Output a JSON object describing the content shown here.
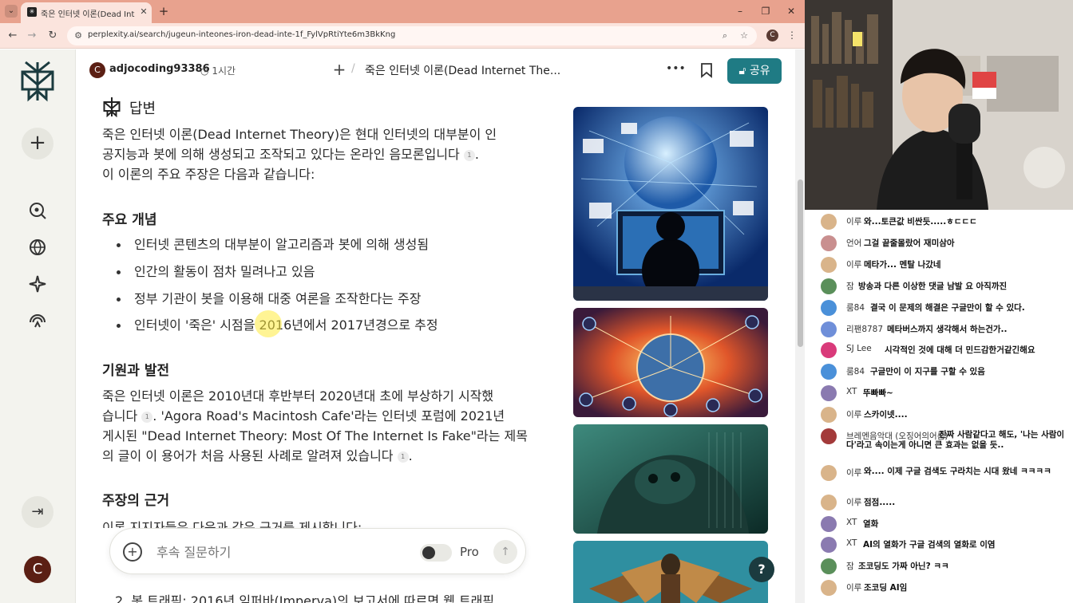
{
  "browser": {
    "tab_title": "죽은 인터넷 이론(Dead Internet",
    "url": "perplexity.ai/search/jugeun-inteones-iron-dead-inte-1f_FylVpRtiYte6m3BkKng",
    "profile_initial": "C"
  },
  "header": {
    "avatar_initial": "C",
    "username": "adjocoding93386",
    "time": "1시간",
    "thread_title": "죽은 인터넷 이론(Dead Internet The...",
    "share_label": "공유"
  },
  "sidebar": {
    "avatar_initial": "C"
  },
  "answer": {
    "heading": "답변",
    "intro_lines": [
      "죽은 인터넷 이론(Dead Internet Theory)은 현대 인터넷의 대부분이 인",
      "공지능과 봇에 의해 생성되고 조작되고 있다는 온라인 음모론입니다",
      "이 이론의 주요 주장은 다음과 같습니다:"
    ],
    "cite_label": "1",
    "section1_title": "주요 개념",
    "bullets": [
      "인터넷 콘텐츠의 대부분이 알고리즘과 봇에 의해 생성됨",
      "인간의 활동이 점차 밀려나고 있음",
      "정부 기관이 봇을 이용해 대중 여론을 조작한다는 주장",
      "인터넷이 '죽은' 시점을 2016년에서 2017년경으로 추정"
    ],
    "section2_title": "기원과 발전",
    "origin_lines": [
      "죽은 인터넷 이론은 2010년대 후반부터 2020년대 초에 부상하기 시작했",
      "습니다",
      ". 'Agora Road's Macintosh Cafe'라는 인터넷 포럼에 2021년",
      "게시된 \"Dead Internet Theory: Most Of The Internet Is Fake\"라는 제목",
      "의 글이 이 용어가 처음 사용된 사례로 알려져 있습니다"
    ],
    "section3_title": "주장의 근거",
    "cut_line": "이론 지지자들은 다음과 같은 근거를 제시합니다:",
    "bottom_item": "2.  봇 트래픽: 2016년 임퍼바(Imperva)의 보고서에 따르면 웹 트래픽"
  },
  "followup": {
    "placeholder": "후속 질문하기",
    "pro_label": "Pro"
  },
  "help_label": "?",
  "chat": [
    {
      "nick": "이루",
      "msg": "와...토큰값 비싼듯.....ㅎㄷㄷㄷ",
      "color": "#d9b48a"
    },
    {
      "nick": "언어",
      "msg": "그걸 끝줄몰랐어 재미삼아",
      "color": "#c98f8f"
    },
    {
      "nick": "이루",
      "msg": "메타가... 멘탈 나갔네",
      "color": "#d9b48a"
    },
    {
      "nick": "잠",
      "msg": "방송과 다른 이상한 댓글 남발 요 아직까진",
      "color": "#5a8f5a"
    },
    {
      "nick": "룸84",
      "msg": "결국 이 문제의 해결은 구글만이 할 수 있다.",
      "color": "#4a90d9"
    },
    {
      "nick": "리팬8787",
      "msg": "메타버스까지 생각해서 하는건가..",
      "color": "#6f8fd9"
    },
    {
      "nick": "SJ Lee",
      "msg": "시각적인 것에 대해 더 민드감한거같긴해요",
      "color": "#d93a7a"
    },
    {
      "nick": "룸84",
      "msg": "구글만이 이 지구를 구할 수 있음",
      "color": "#4a90d9"
    },
    {
      "nick": "XT",
      "msg": "뚜빠빠~",
      "color": "#8a7ab0"
    },
    {
      "nick": "이루",
      "msg": "스카이넷....",
      "color": "#d9b48a"
    },
    {
      "nick": "브레멘음악대 (오징어의어름)",
      "msg": "진짜 사람같다고 해도, '나는 사람이다'라고 속이는게 아니면 큰 효과는 없을 듯..",
      "color": "#a33a3a"
    },
    {
      "nick": "이루",
      "msg": "와.... 이제 구글 검색도 구라치는 시대 왔네 ㅋㅋㅋㅋ",
      "color": "#d9b48a"
    },
    {
      "nick": "이루",
      "msg": "점점.....",
      "color": "#d9b48a"
    },
    {
      "nick": "XT",
      "msg": "열화",
      "color": "#8a7ab0"
    },
    {
      "nick": "XT",
      "msg": "AI의 열화가 구글 검색의 열화로 이염",
      "color": "#8a7ab0"
    },
    {
      "nick": "잠",
      "msg": "조코딩도 가짜 아닌? ㅋㅋ",
      "color": "#5a8f5a"
    },
    {
      "nick": "이루",
      "msg": "조코딩 AI임",
      "color": "#d9b48a"
    }
  ]
}
